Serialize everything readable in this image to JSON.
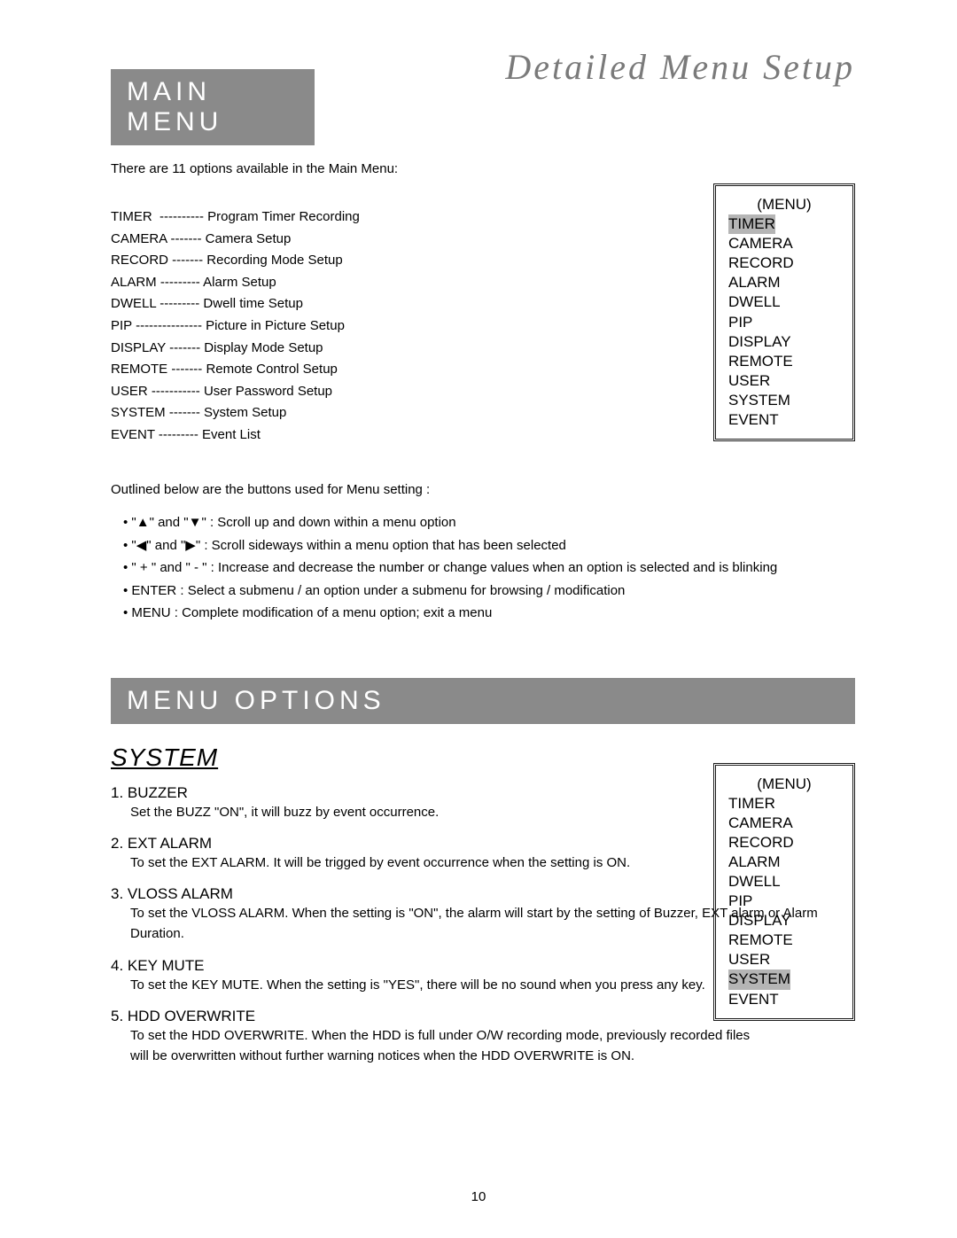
{
  "header": {
    "page_title": "Detailed Menu Setup",
    "main_menu_bar": "MAIN MENU",
    "menu_options_bar": "MENU OPTIONS"
  },
  "main_menu": {
    "intro": "There are 11 options available in the Main Menu:",
    "options": [
      {
        "name": "TIMER",
        "dashes": "  ----------",
        "desc": " Program Timer Recording"
      },
      {
        "name": "CAMERA",
        "dashes": " -------",
        "desc": " Camera Setup"
      },
      {
        "name": "RECORD",
        "dashes": " -------",
        "desc": " Recording Mode Setup"
      },
      {
        "name": "ALARM",
        "dashes": " ---------",
        "desc": " Alarm Setup"
      },
      {
        "name": "DWELL",
        "dashes": " ---------",
        "desc": " Dwell time Setup"
      },
      {
        "name": "PIP",
        "dashes": " ---------------",
        "desc": " Picture in Picture Setup"
      },
      {
        "name": "DISPLAY",
        "dashes": " -------",
        "desc": " Display Mode Setup"
      },
      {
        "name": "REMOTE",
        "dashes": " -------",
        "desc": " Remote Control Setup"
      },
      {
        "name": "USER",
        "dashes": " -----------",
        "desc": " User Password Setup"
      },
      {
        "name": "SYSTEM",
        "dashes": " -------",
        "desc": " System Setup"
      },
      {
        "name": "EVENT",
        "dashes": " ---------",
        "desc": " Event List"
      }
    ]
  },
  "menu_box_1": {
    "header": "(MENU)",
    "items": [
      "TIMER",
      "CAMERA",
      "RECORD",
      "ALARM",
      "DWELL",
      "PIP",
      "DISPLAY",
      "REMOTE",
      "USER",
      "SYSTEM",
      "EVENT"
    ],
    "highlighted_index": 0
  },
  "instructions": {
    "lead": "Outlined below are the buttons used for Menu setting :",
    "lines": [
      "\"▲\" and \"▼\" : Scroll up and down within a menu option",
      "\"◀\" and \"▶\" : Scroll sideways within a menu option that has been selected",
      "\" + \" and \" - \" : Increase and decrease the number or change values when an option is selected and is blinking",
      "ENTER : Select a submenu / an option under a submenu for browsing / modification",
      "MENU : Complete modification of a menu option; exit a menu"
    ]
  },
  "system_section": {
    "title": "SYSTEM",
    "items": [
      {
        "title": "1. BUZZER",
        "desc": "Set the BUZZ \"ON\", it will buzz by event occurrence."
      },
      {
        "title": "2. EXT ALARM",
        "desc": "To set the EXT ALARM. It will be trigged by event occurrence when the setting is ON."
      },
      {
        "title": "3. VLOSS ALARM",
        "desc": "To set the VLOSS ALARM. When the setting is \"ON\", the alarm will start by the setting of Buzzer, EXT alarm or Alarm Duration."
      },
      {
        "title": "4. KEY MUTE",
        "desc": "To set the KEY MUTE. When the setting is \"YES\", there will be no sound when you press any key."
      },
      {
        "title": "5. HDD OVERWRITE",
        "desc": "To set the HDD OVERWRITE. When the HDD is full under O/W recording mode, previously recorded files will be overwritten without further warning notices when the HDD OVERWRITE is ON."
      }
    ]
  },
  "menu_box_2": {
    "header": "(MENU)",
    "items": [
      "TIMER",
      "CAMERA",
      "RECORD",
      "ALARM",
      "DWELL",
      "PIP",
      "DISPLAY",
      "REMOTE",
      "USER",
      "SYSTEM",
      "EVENT"
    ],
    "highlighted_index": 9
  },
  "page_number": "10"
}
